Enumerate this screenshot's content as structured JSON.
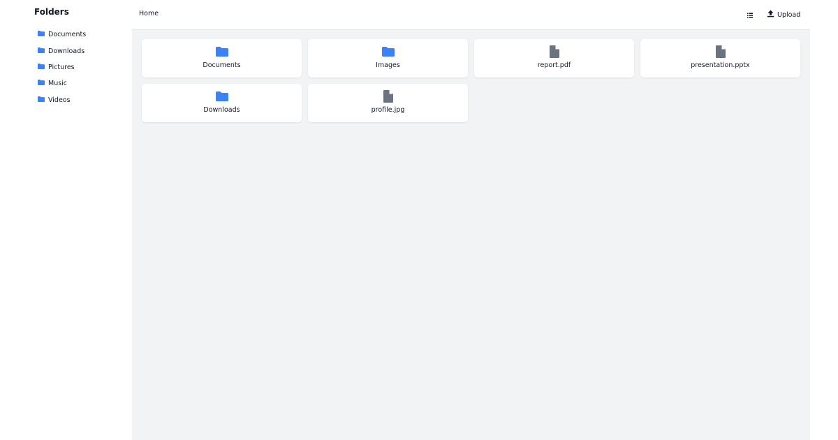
{
  "sidebar": {
    "title": "Folders",
    "items": [
      {
        "label": "Documents"
      },
      {
        "label": "Downloads"
      },
      {
        "label": "Pictures"
      },
      {
        "label": "Music"
      },
      {
        "label": "Videos"
      }
    ]
  },
  "topbar": {
    "breadcrumb": "Home",
    "view_toggle_icon": "list-view-icon",
    "upload_label": "Upload",
    "upload_icon": "upload-icon"
  },
  "files": [
    {
      "name": "Documents",
      "type": "folder"
    },
    {
      "name": "Images",
      "type": "folder"
    },
    {
      "name": "report.pdf",
      "type": "file"
    },
    {
      "name": "presentation.pptx",
      "type": "file"
    },
    {
      "name": "Downloads",
      "type": "folder"
    },
    {
      "name": "profile.jpg",
      "type": "file"
    }
  ],
  "colors": {
    "folder": "#3b82f6",
    "file": "#6b7280",
    "content_bg": "#f2f3f5"
  }
}
